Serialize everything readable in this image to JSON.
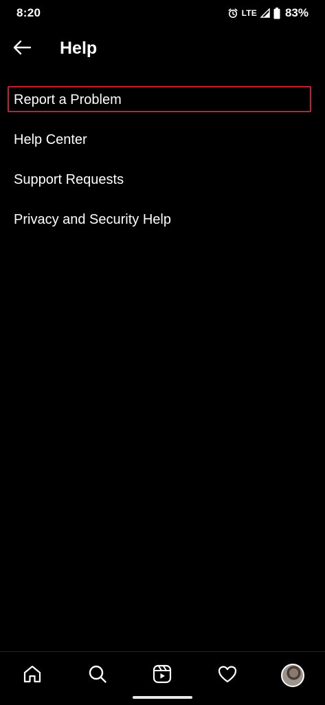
{
  "status_bar": {
    "time": "8:20",
    "network": "LTE",
    "battery": "83%",
    "icons": [
      "alarm-icon",
      "signal-icon",
      "battery-icon"
    ]
  },
  "header": {
    "title": "Help",
    "back_icon": "arrow-left-icon"
  },
  "menu": {
    "items": [
      {
        "label": "Report a Problem",
        "highlighted": true
      },
      {
        "label": "Help Center"
      },
      {
        "label": "Support Requests"
      },
      {
        "label": "Privacy and Security Help"
      }
    ]
  },
  "bottom_nav": {
    "items": [
      "home-icon",
      "search-icon",
      "reels-icon",
      "heart-icon",
      "profile-avatar"
    ]
  },
  "colors": {
    "background": "#000000",
    "text": "#ffffff",
    "highlight_border": "#c8202a"
  }
}
